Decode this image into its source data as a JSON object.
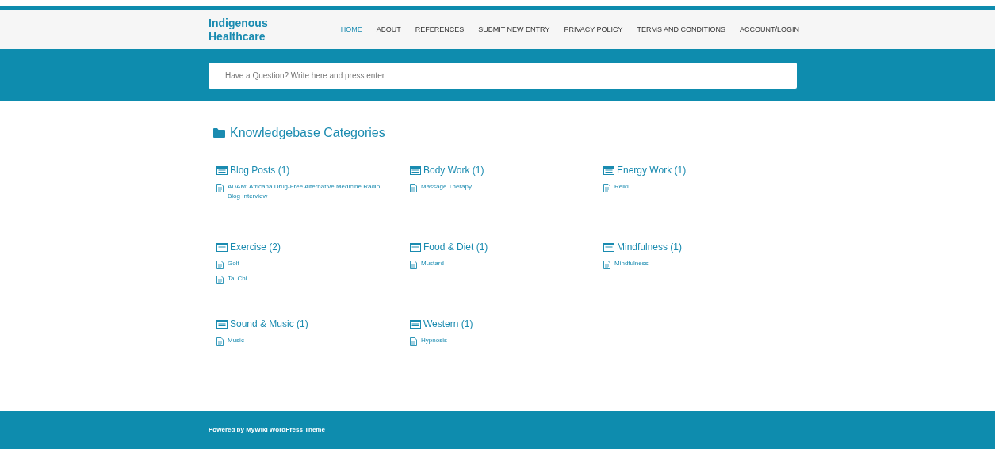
{
  "site": {
    "title": "Indigenous Healthcare"
  },
  "nav": [
    {
      "label": "HOME",
      "selected": true
    },
    {
      "label": "ABOUT",
      "selected": false
    },
    {
      "label": "REFERENCES",
      "selected": false
    },
    {
      "label": "SUBMIT NEW ENTRY",
      "selected": false
    },
    {
      "label": "PRIVACY POLICY",
      "selected": false
    },
    {
      "label": "TERMS AND CONDITIONS",
      "selected": false
    },
    {
      "label": "ACCOUNT/LOGIN",
      "selected": false
    }
  ],
  "search": {
    "placeholder": "Have a Question? Write here and press enter"
  },
  "heading": "Knowledgebase Categories",
  "categories": [
    {
      "title": "Blog Posts (1)",
      "articles": [
        "ADAM: Africana Drug-Free Alternative Medicine Radio Blog Interview"
      ]
    },
    {
      "title": "Body Work (1)",
      "articles": [
        "Massage Therapy"
      ]
    },
    {
      "title": "Energy Work (1)",
      "articles": [
        "Reiki"
      ]
    },
    {
      "title": "Exercise (2)",
      "articles": [
        "Golf",
        "Tai Chi"
      ]
    },
    {
      "title": "Food & Diet (1)",
      "articles": [
        "Mustard"
      ]
    },
    {
      "title": "Mindfulness (1)",
      "articles": [
        "Mindfulness"
      ]
    },
    {
      "title": "Sound & Music (1)",
      "articles": [
        "Music"
      ]
    },
    {
      "title": "Western (1)",
      "articles": [
        "Hypnosis"
      ]
    }
  ],
  "footer": {
    "text": "Powered by MyWiki WordPress Theme"
  }
}
